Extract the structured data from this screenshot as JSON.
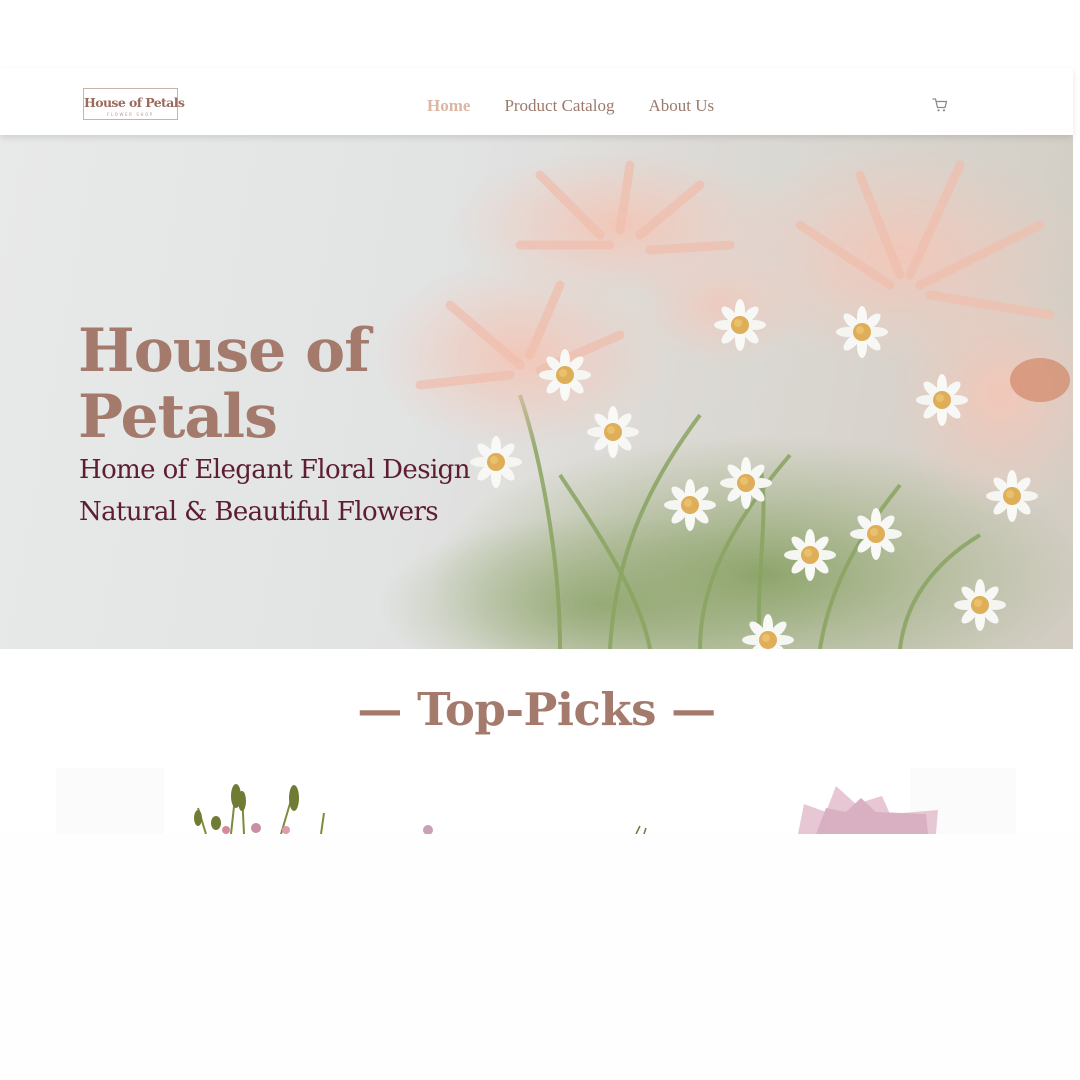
{
  "header": {
    "logo": {
      "title": "House of Petals",
      "subtitle": "FLOWER SHOP"
    },
    "nav": [
      {
        "label": "Home",
        "active": true
      },
      {
        "label": "Product Catalog",
        "active": false
      },
      {
        "label": "About Us",
        "active": false
      }
    ],
    "cart_icon": "shopping-cart-icon"
  },
  "hero": {
    "title_line1": "House of",
    "title_line2": "Petals",
    "subtitle_line1": "Home of Elegant Floral Design",
    "subtitle_line2": "Natural & Beautiful Flowers"
  },
  "top_picks": {
    "title": "— Top-Picks —"
  },
  "colors": {
    "brand": "#a47a6c",
    "nav_active": "#dbb7a3",
    "nav_text": "#9b7a6c",
    "hero_subtitle": "#5e1e32"
  }
}
